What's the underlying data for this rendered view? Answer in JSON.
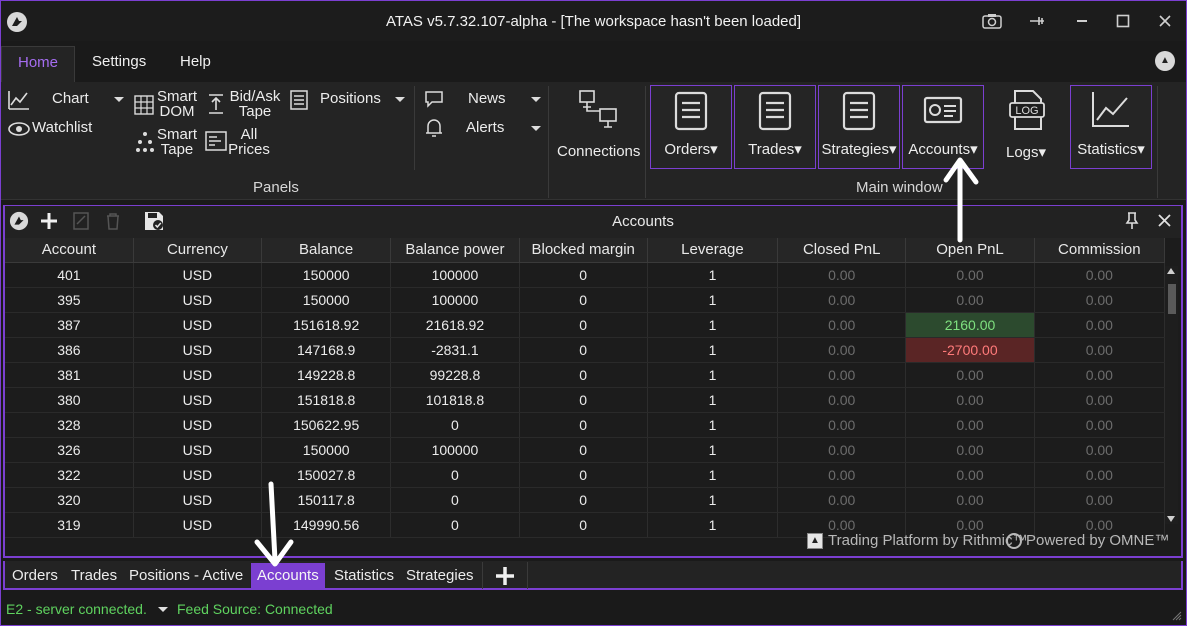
{
  "window": {
    "title": "ATAS v5.7.32.107-alpha - [The workspace hasn't been loaded]",
    "controls": [
      "camera-icon",
      "pin-icon",
      "minimize-icon",
      "maximize-icon",
      "close-icon"
    ]
  },
  "ribbon_tabs": [
    {
      "label": "Home",
      "active": true
    },
    {
      "label": "Settings",
      "active": false
    },
    {
      "label": "Help",
      "active": false
    }
  ],
  "ribbon": {
    "chart": "Chart",
    "watchlist": "Watchlist",
    "smart_dom_1": "Smart",
    "smart_dom_2": "DOM",
    "bidask_1": "Bid/Ask",
    "bidask_2": "Tape",
    "positions": "Positions",
    "smart_tape_1": "Smart",
    "smart_tape_2": "Tape",
    "all_prices_1": "All",
    "all_prices_2": "Prices",
    "news": "News",
    "alerts": "Alerts",
    "panels_group": "Panels",
    "connections": "Connections",
    "main_window_group": "Main window",
    "orders": "Orders",
    "trades": "Trades",
    "strategies": "Strategies",
    "accounts": "Accounts",
    "logs": "Logs",
    "logs_icon_text": "LOG",
    "statistics": "Statistics"
  },
  "panel": {
    "title": "Accounts",
    "columns": [
      "Account",
      "Currency",
      "Balance",
      "Balance power",
      "Blocked margin",
      "Leverage",
      "Closed PnL",
      "Open PnL",
      "Commission"
    ],
    "rows": [
      [
        "401",
        "USD",
        "150000",
        "100000",
        "0",
        "1",
        "0.00",
        "0.00",
        "0.00"
      ],
      [
        "395",
        "USD",
        "150000",
        "100000",
        "0",
        "1",
        "0.00",
        "0.00",
        "0.00"
      ],
      [
        "387",
        "USD",
        "151618.92",
        "21618.92",
        "0",
        "1",
        "0.00",
        "2160.00",
        "0.00"
      ],
      [
        "386",
        "USD",
        "147168.9",
        "-2831.1",
        "0",
        "1",
        "0.00",
        "-2700.00",
        "0.00"
      ],
      [
        "381",
        "USD",
        "149228.8",
        "99228.8",
        "0",
        "1",
        "0.00",
        "0.00",
        "0.00"
      ],
      [
        "380",
        "USD",
        "151818.8",
        "101818.8",
        "0",
        "1",
        "0.00",
        "0.00",
        "0.00"
      ],
      [
        "328",
        "USD",
        "150622.95",
        "0",
        "0",
        "1",
        "0.00",
        "0.00",
        "0.00"
      ],
      [
        "326",
        "USD",
        "150000",
        "100000",
        "0",
        "1",
        "0.00",
        "0.00",
        "0.00"
      ],
      [
        "322",
        "USD",
        "150027.8",
        "0",
        "0",
        "1",
        "0.00",
        "0.00",
        "0.00"
      ],
      [
        "320",
        "USD",
        "150117.8",
        "0",
        "0",
        "1",
        "0.00",
        "0.00",
        "0.00"
      ],
      [
        "319",
        "USD",
        "149990.56",
        "0",
        "0",
        "1",
        "0.00",
        "0.00",
        "0.00"
      ]
    ],
    "footer_left": "Trading Platform by Rithmic™",
    "footer_right": "Powered by OMNE™"
  },
  "bottom_tabs": [
    {
      "label": "Orders",
      "active": false
    },
    {
      "label": "Trades",
      "active": false
    },
    {
      "label": "Positions - Active",
      "active": false
    },
    {
      "label": "Accounts",
      "active": true
    },
    {
      "label": "Statistics",
      "active": false
    },
    {
      "label": "Strategies",
      "active": false
    }
  ],
  "status": {
    "server": "E2 - server connected.",
    "feed": "Feed Source: Connected"
  },
  "colors": {
    "accent": "#7b3fd1",
    "positive": "#7fe07f",
    "negative": "#ff7a7a",
    "status_green": "#5fd35f"
  }
}
